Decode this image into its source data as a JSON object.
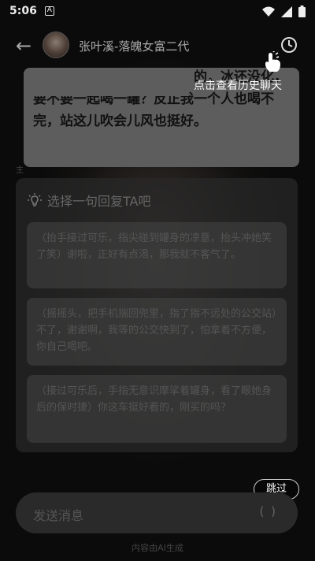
{
  "status_bar": {
    "time": "5:06",
    "notification_icon": "A"
  },
  "header": {
    "title": "张叶溪-落魄女富二代"
  },
  "tooltip": {
    "text": "点击查看历史聊天"
  },
  "message": {
    "text": "侧身递了递手里的另一罐》的，冰还没化，要不要一起喝一罐？反正我一个人也喝不完，站这儿吹会儿风也挺好。"
  },
  "side_mark": "主",
  "reply_panel": {
    "title": "选择一句回复TA吧",
    "options": [
      "（抬手接过可乐，指尖碰到罐身的凉意，抬头冲她笑了笑）谢啦，正好有点渴，那我就不客气了。",
      "（摇摇头，把手机揣回兜里，指了指不远处的公交站）不了，谢谢啊，我等的公交快到了，怕拿着不方便，你自己喝吧。",
      "（接过可乐后，手指无意识摩挲着罐身，看了眼她身后的保时捷）你这车挺好看的，刚买的吗？"
    ]
  },
  "skip_label": "跳过",
  "input": {
    "placeholder": "发送消息",
    "paren": "( )"
  },
  "footer": "内容由AI生成"
}
